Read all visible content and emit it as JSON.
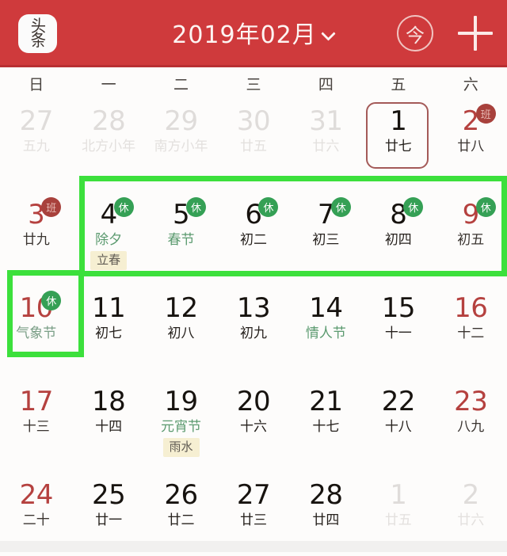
{
  "header": {
    "logo_label": "头条",
    "logo_line1": "头",
    "logo_line2": "条",
    "title": "2019年02月",
    "dropdown_icon": "chevron-down-icon",
    "today_label": "今",
    "add_label": "+",
    "background_color": "#cf3a3c"
  },
  "weekdays": [
    "日",
    "一",
    "二",
    "三",
    "四",
    "五",
    "六"
  ],
  "highlight_color": "#3ce03c",
  "selected_border_color": "#a45a58",
  "badges": {
    "rest": "休",
    "work": "班",
    "rest_color": "#35a055",
    "work_color": "#a8413c"
  },
  "weeks": [
    [
      {
        "day": "27",
        "sub": "五九",
        "style": "out"
      },
      {
        "day": "28",
        "sub": "北方小年",
        "style": "out"
      },
      {
        "day": "29",
        "sub": "南方小年",
        "style": "out"
      },
      {
        "day": "30",
        "sub": "廿五",
        "style": "out"
      },
      {
        "day": "31",
        "sub": "廿六",
        "style": "out"
      },
      {
        "day": "1",
        "sub": "廿七",
        "style": "normal",
        "selected": true
      },
      {
        "day": "2",
        "sub": "廿八",
        "style": "red",
        "badge": "work"
      }
    ],
    [
      {
        "day": "3",
        "sub": "廿九",
        "style": "red",
        "badge": "work"
      },
      {
        "day": "4",
        "sub": "除夕",
        "style": "fest",
        "badge": "rest",
        "term": "立春"
      },
      {
        "day": "5",
        "sub": "春节",
        "style": "fest",
        "badge": "rest"
      },
      {
        "day": "6",
        "sub": "初二",
        "style": "normal",
        "badge": "rest"
      },
      {
        "day": "7",
        "sub": "初三",
        "style": "normal",
        "badge": "rest"
      },
      {
        "day": "8",
        "sub": "初四",
        "style": "normal",
        "badge": "rest"
      },
      {
        "day": "9",
        "sub": "初五",
        "style": "red",
        "badge": "rest"
      }
    ],
    [
      {
        "day": "10",
        "sub": "气象节",
        "style": "fest-red",
        "badge": "rest"
      },
      {
        "day": "11",
        "sub": "初七",
        "style": "normal"
      },
      {
        "day": "12",
        "sub": "初八",
        "style": "normal"
      },
      {
        "day": "13",
        "sub": "初九",
        "style": "normal"
      },
      {
        "day": "14",
        "sub": "情人节",
        "style": "fest"
      },
      {
        "day": "15",
        "sub": "十一",
        "style": "normal"
      },
      {
        "day": "16",
        "sub": "十二",
        "style": "red"
      }
    ],
    [
      {
        "day": "17",
        "sub": "十三",
        "style": "red"
      },
      {
        "day": "18",
        "sub": "十四",
        "style": "normal"
      },
      {
        "day": "19",
        "sub": "元宵节",
        "style": "fest",
        "term": "雨水"
      },
      {
        "day": "20",
        "sub": "十六",
        "style": "normal"
      },
      {
        "day": "21",
        "sub": "十七",
        "style": "normal"
      },
      {
        "day": "22",
        "sub": "十八",
        "style": "normal"
      },
      {
        "day": "23",
        "sub": "八九",
        "style": "red"
      }
    ],
    [
      {
        "day": "24",
        "sub": "二十",
        "style": "red"
      },
      {
        "day": "25",
        "sub": "廿一",
        "style": "normal"
      },
      {
        "day": "26",
        "sub": "廿二",
        "style": "normal"
      },
      {
        "day": "27",
        "sub": "廿三",
        "style": "normal"
      },
      {
        "day": "28",
        "sub": "廿四",
        "style": "normal"
      },
      {
        "day": "1",
        "sub": "廿五",
        "style": "out"
      },
      {
        "day": "2",
        "sub": "廿六",
        "style": "out"
      }
    ]
  ]
}
